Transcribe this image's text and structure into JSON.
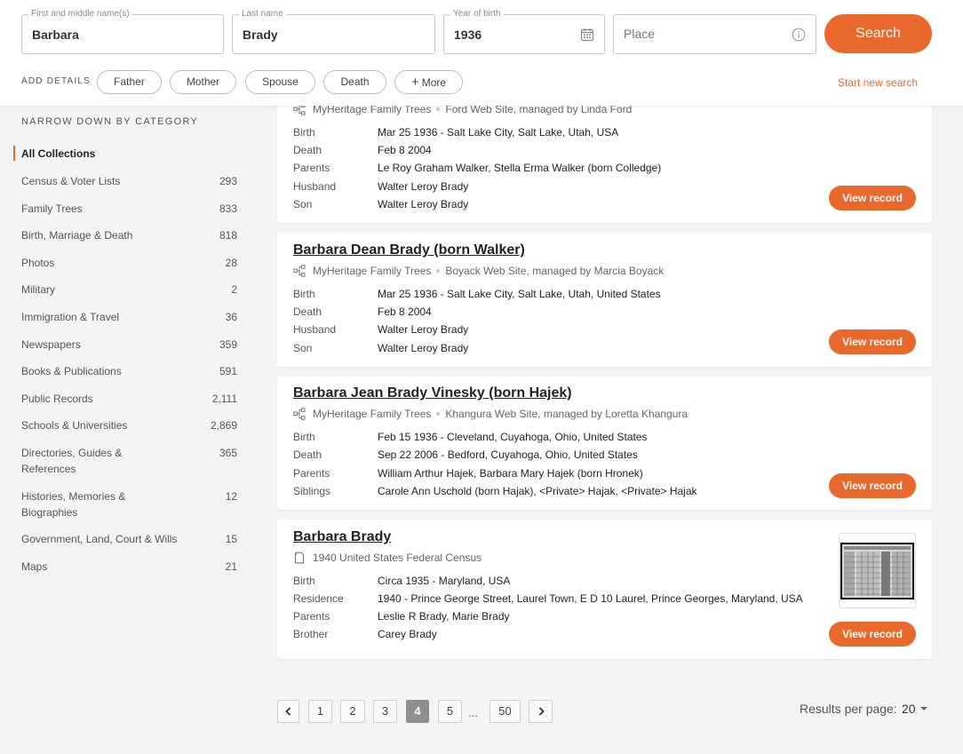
{
  "search": {
    "first_name": {
      "label": "First and middle name(s)",
      "value": "Barbara"
    },
    "last_name": {
      "label": "Last name",
      "value": "Brady"
    },
    "year_of_birth": {
      "label": "Year of birth",
      "value": "1936",
      "icon": "calendar-icon"
    },
    "place": {
      "placeholder": "Place",
      "icon": "info-icon"
    },
    "search_button": "Search",
    "add_details_label": "ADD DETAILS",
    "detail_pills": [
      "Father",
      "Mother",
      "Spouse",
      "Death",
      "More"
    ],
    "start_new_search": "Start new search",
    "accent_color": "#e9692c"
  },
  "sidebar": {
    "title": "NARROW DOWN BY CATEGORY",
    "categories": [
      {
        "name": "All Collections",
        "count": ""
      },
      {
        "name": "Census & Voter Lists",
        "count": "293"
      },
      {
        "name": "Family Trees",
        "count": "833"
      },
      {
        "name": "Birth, Marriage & Death",
        "count": "818"
      },
      {
        "name": "Photos",
        "count": "28"
      },
      {
        "name": "Military",
        "count": "2"
      },
      {
        "name": "Immigration & Travel",
        "count": "36"
      },
      {
        "name": "Newspapers",
        "count": "359"
      },
      {
        "name": "Books & Publications",
        "count": "591"
      },
      {
        "name": "Public Records",
        "count": "2,111"
      },
      {
        "name": "Schools & Universities",
        "count": "2,869"
      },
      {
        "name": "Directories, Guides & References",
        "count": "365"
      },
      {
        "name": "Histories, Memories & Biographies",
        "count": "12"
      },
      {
        "name": "Government, Land, Court & Wills",
        "count": "15"
      },
      {
        "name": "Maps",
        "count": "21"
      }
    ]
  },
  "results": [
    {
      "title": "",
      "source_collection": "MyHeritage Family Trees",
      "source_site": "Ford Web Site, managed by Linda Ford",
      "fields": [
        {
          "label": "Birth",
          "value": "Mar 25 1936 - Salt Lake City, Salt Lake, Utah, USA"
        },
        {
          "label": "Death",
          "value": "Feb 8 2004"
        },
        {
          "label": "Parents",
          "value": "Le Roy Graham Walker, Stella Erma Walker (born Colledge)"
        },
        {
          "label": "Husband",
          "value": "Walter Leroy Brady"
        },
        {
          "label": "Son",
          "value": "Walter Leroy Brady"
        }
      ],
      "view_button": "View record"
    },
    {
      "title": "Barbara Dean Brady (born Walker)",
      "source_collection": "MyHeritage Family Trees",
      "source_site": "Boyack Web Site, managed by Marcia Boyack",
      "fields": [
        {
          "label": "Birth",
          "value": "Mar 25 1936 - Salt Lake City, Salt Lake, Utah, United States"
        },
        {
          "label": "Death",
          "value": "Feb 8 2004"
        },
        {
          "label": "Husband",
          "value": "Walter Leroy Brady"
        },
        {
          "label": "Son",
          "value": "Walter Leroy Brady"
        }
      ],
      "view_button": "View record"
    },
    {
      "title": "Barbara Jean Brady Vinesky (born Hajek)",
      "source_collection": "MyHeritage Family Trees",
      "source_site": "Khangura Web Site, managed by Loretta Khangura",
      "fields": [
        {
          "label": "Birth",
          "value": "Feb 15 1936 - Cleveland, Cuyahoga, Ohio, United States"
        },
        {
          "label": "Death",
          "value": "Sep 22 2006 - Bedford, Cuyahoga, Ohio, United States"
        },
        {
          "label": "Parents",
          "value": "William Arthur Hajek, Barbara Mary Hajek (born Hronek)"
        },
        {
          "label": "Siblings",
          "value": "Carole Ann Uschold (born Hajak), <Private> Hajak, <Private> Hajak"
        }
      ],
      "view_button": "View record"
    },
    {
      "title": "Barbara Brady",
      "source_collection": "1940 United States Federal Census",
      "source_site": "",
      "fields": [
        {
          "label": "Birth",
          "value": "Circa 1935 - Maryland, USA"
        },
        {
          "label": "Residence",
          "value": "1940 - Prince George Street, Laurel Town, E D 10 Laurel, Prince Georges, Maryland, USA"
        },
        {
          "label": "Parents",
          "value": "Leslie R Brady, Marie Brady"
        },
        {
          "label": "Brother",
          "value": "Carey Brady"
        }
      ],
      "view_button": "View record"
    }
  ],
  "pagination": {
    "pages": [
      "1",
      "2",
      "3",
      "4",
      "5",
      "50"
    ],
    "current": "4",
    "ellipsis": "...",
    "results_per_page_label": "Results per page:",
    "results_per_page_value": "20"
  }
}
